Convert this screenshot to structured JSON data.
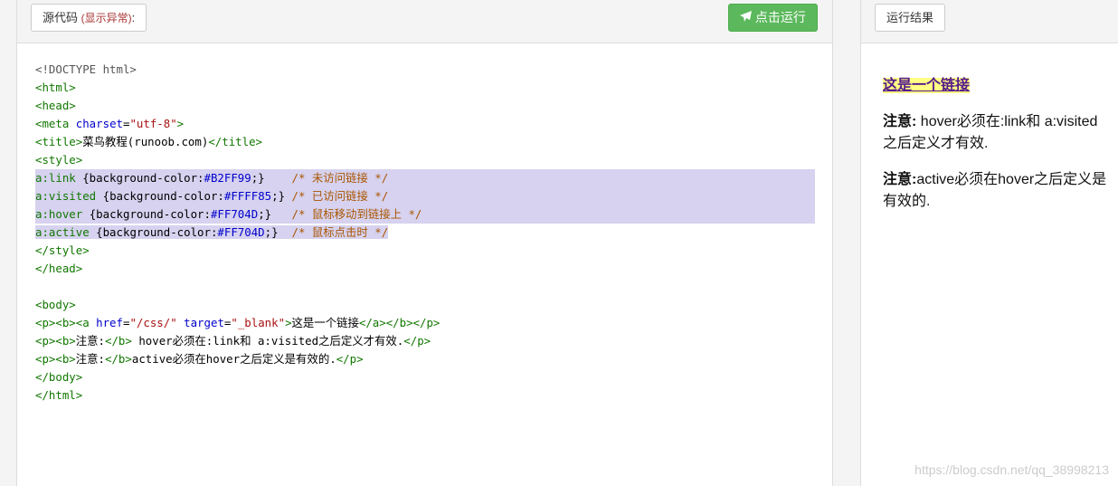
{
  "left": {
    "source_label": "源代码",
    "source_warn": "(显示异常)",
    "source_colon": ":",
    "run_icon": "paper-plane-icon",
    "run_label": "点击运行"
  },
  "code": [
    [
      [
        "dt",
        "<!DOCTYPE html>"
      ]
    ],
    [
      [
        "tag",
        "<html>"
      ]
    ],
    [
      [
        "tag",
        "<head>"
      ]
    ],
    [
      [
        "tag",
        "<meta "
      ],
      [
        "attr",
        "charset"
      ],
      [
        "txt",
        "="
      ],
      [
        "str",
        "\"utf-8\""
      ],
      [
        "tag",
        ">"
      ]
    ],
    [
      [
        "tag",
        "<title>"
      ],
      [
        "txt",
        "菜鸟教程(runoob.com)"
      ],
      [
        "tag",
        "</title>"
      ]
    ],
    [
      [
        "tag",
        "<style>"
      ]
    ],
    [
      [
        "sel",
        "a:link "
      ],
      [
        "prop",
        "{background-color:"
      ],
      [
        "attr",
        "#B2FF99"
      ],
      [
        "prop",
        ";}    "
      ],
      [
        "com",
        "/* 未访问链接 */"
      ]
    ],
    [
      [
        "sel",
        "a:visited "
      ],
      [
        "prop",
        "{background-color:"
      ],
      [
        "attr",
        "#FFFF85"
      ],
      [
        "prop",
        ";} "
      ],
      [
        "com",
        "/* 已访问链接 */"
      ]
    ],
    [
      [
        "sel",
        "a:hover "
      ],
      [
        "prop",
        "{background-color:"
      ],
      [
        "attr",
        "#FF704D"
      ],
      [
        "prop",
        ";}   "
      ],
      [
        "com",
        "/* 鼠标移动到链接上 */"
      ]
    ],
    [
      [
        "sel",
        "a:active "
      ],
      [
        "prop",
        "{background-color:"
      ],
      [
        "attr",
        "#FF704D"
      ],
      [
        "prop",
        ";}  "
      ],
      [
        "com",
        "/* 鼠标点击时 */"
      ]
    ],
    [
      [
        "tag",
        "</style>"
      ]
    ],
    [
      [
        "tag",
        "</head>"
      ]
    ],
    [],
    [
      [
        "tag",
        "<body>"
      ]
    ],
    [
      [
        "tag",
        "<p><b><a "
      ],
      [
        "attr",
        "href"
      ],
      [
        "txt",
        "="
      ],
      [
        "str",
        "\"/css/\" "
      ],
      [
        "attr",
        "target"
      ],
      [
        "txt",
        "="
      ],
      [
        "str",
        "\"_blank\""
      ],
      [
        "tag",
        ">"
      ],
      [
        "txt",
        "这是一个链接"
      ],
      [
        "tag",
        "</a></b></p>"
      ]
    ],
    [
      [
        "tag",
        "<p><b>"
      ],
      [
        "txt",
        "注意:"
      ],
      [
        "tag",
        "</b>"
      ],
      [
        "txt",
        " hover必须在:link和 a:visited之后定义才有效."
      ],
      [
        "tag",
        "</p>"
      ]
    ],
    [
      [
        "tag",
        "<p><b>"
      ],
      [
        "txt",
        "注意:"
      ],
      [
        "tag",
        "</b>"
      ],
      [
        "txt",
        "active必须在hover之后定义是有效的."
      ],
      [
        "tag",
        "</p>"
      ]
    ],
    [
      [
        "tag",
        "</body>"
      ]
    ],
    [
      [
        "tag",
        "</html>"
      ]
    ]
  ],
  "right": {
    "result_label": "运行结果",
    "link_text": "这是一个链接",
    "note1_bold": "注意:",
    "note1_text": " hover必须在:link和 a:visited之后定义才有效.",
    "note2_bold": "注意:",
    "note2_text": "active必须在hover之后定义是有效的."
  },
  "watermark": "https://blog.csdn.net/qq_38998213"
}
